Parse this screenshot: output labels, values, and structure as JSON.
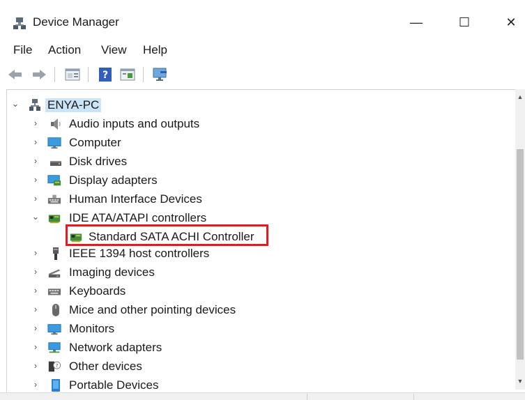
{
  "window": {
    "title": "Device Manager",
    "icon": "device-manager-icon",
    "controls": {
      "minimize": "—",
      "maximize": "☐",
      "close": "✕"
    }
  },
  "menu": [
    "File",
    "Action",
    "View",
    "Help"
  ],
  "toolbar": [
    "back-icon",
    "forward-icon",
    "properties-icon",
    "help-icon",
    "show-hide-console-tree-icon",
    "scan-hardware-icon"
  ],
  "tree": {
    "root": {
      "label": "ENYA-PC",
      "icon": "computer-network-icon",
      "expanded": true
    },
    "nodes": [
      {
        "label": "Audio inputs and outputs",
        "icon": "speaker-icon",
        "expanded": false
      },
      {
        "label": "Computer",
        "icon": "monitor-icon",
        "expanded": false
      },
      {
        "label": "Disk drives",
        "icon": "disk-drive-icon",
        "expanded": false
      },
      {
        "label": "Display adapters",
        "icon": "display-adapter-icon",
        "expanded": false
      },
      {
        "label": "Human Interface Devices",
        "icon": "keyboard-device-icon",
        "expanded": false
      },
      {
        "label": "IDE ATA/ATAPI controllers",
        "icon": "controller-card-icon",
        "expanded": true,
        "children": [
          {
            "label": "Standard SATA ACHI Controller",
            "icon": "controller-card-icon",
            "highlighted": true
          }
        ]
      },
      {
        "label": "IEEE 1394 host controllers",
        "icon": "firewire-plug-icon",
        "expanded": false
      },
      {
        "label": "Imaging devices",
        "icon": "scanner-icon",
        "expanded": false
      },
      {
        "label": "Keyboards",
        "icon": "keyboard-icon",
        "expanded": false
      },
      {
        "label": "Mice and other pointing devices",
        "icon": "mouse-icon",
        "expanded": false
      },
      {
        "label": "Monitors",
        "icon": "monitor-icon",
        "expanded": false
      },
      {
        "label": "Network adapters",
        "icon": "network-adapter-icon",
        "expanded": false
      },
      {
        "label": "Other devices",
        "icon": "unknown-device-icon",
        "expanded": false
      },
      {
        "label": "Portable Devices",
        "icon": "portable-device-icon",
        "expanded": false
      }
    ]
  },
  "colors": {
    "selection": "#cce4f7",
    "highlight_border": "#e01b24",
    "accent_blue": "#1e88d8"
  }
}
